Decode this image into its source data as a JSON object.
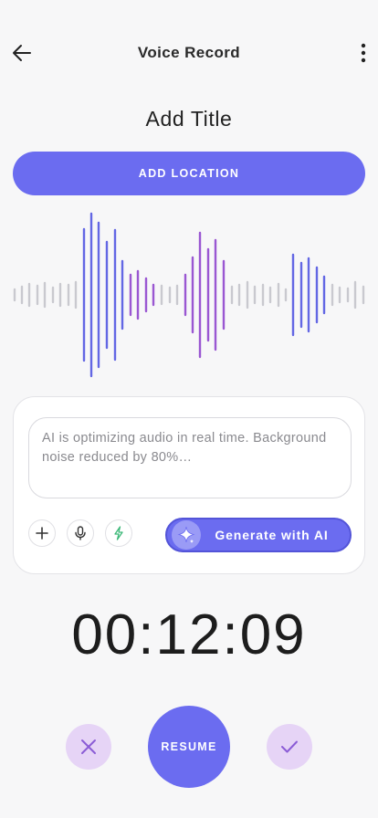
{
  "header": {
    "title": "Voice Record",
    "back_icon": "arrow-left-icon",
    "more_icon": "more-vertical-icon"
  },
  "page_title": "Add Title",
  "location_button": "ADD LOCATION",
  "waveform": {
    "colors": {
      "blue": "#6367e4",
      "purple": "#9a57d2",
      "grey": "#c9c9cf"
    }
  },
  "ai_panel": {
    "status_text": "AI is optimizing audio in real time. Background noise reduced by 80%…",
    "tools": [
      "plus-icon",
      "microphone-icon",
      "lightning-icon"
    ],
    "generate_label": "Generate with AI",
    "generate_icon": "sparkle-icon"
  },
  "timer": "00:12:09",
  "controls": {
    "cancel_icon": "close-icon",
    "resume_label": "RESUME",
    "confirm_icon": "check-icon"
  },
  "colors": {
    "accent": "#6b6cf0",
    "accent_soft": "#e6d4f6",
    "background": "#f7f7f8"
  }
}
